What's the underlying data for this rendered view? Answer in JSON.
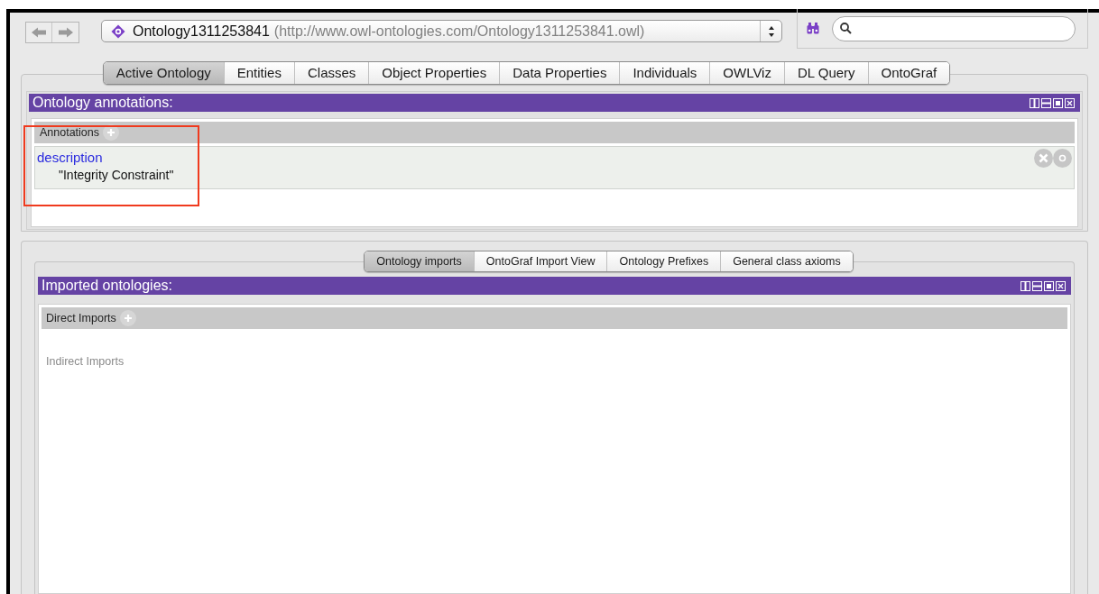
{
  "ontology_selector": {
    "name": "Ontology1311253841",
    "iri": "(http://www.owl-ontologies.com/Ontology1311253841.owl)"
  },
  "tabs": [
    {
      "label": "Active Ontology",
      "selected": true
    },
    {
      "label": "Entities",
      "selected": false
    },
    {
      "label": "Classes",
      "selected": false
    },
    {
      "label": "Object Properties",
      "selected": false
    },
    {
      "label": "Data Properties",
      "selected": false
    },
    {
      "label": "Individuals",
      "selected": false
    },
    {
      "label": "OWLViz",
      "selected": false
    },
    {
      "label": "DL Query",
      "selected": false
    },
    {
      "label": "OntoGraf",
      "selected": false
    }
  ],
  "annotations_view": {
    "title": "Ontology annotations:",
    "section": "Annotations",
    "annotations": [
      {
        "property": "description",
        "value": "\"Integrity Constraint\""
      }
    ]
  },
  "subtabs": [
    {
      "label": "Ontology imports",
      "selected": true
    },
    {
      "label": "OntoGraf Import View",
      "selected": false
    },
    {
      "label": "Ontology Prefixes",
      "selected": false
    },
    {
      "label": "General class axioms",
      "selected": false
    }
  ],
  "imports_view": {
    "title": "Imported ontologies:",
    "direct_section": "Direct Imports",
    "indirect_section": "Indirect Imports"
  }
}
